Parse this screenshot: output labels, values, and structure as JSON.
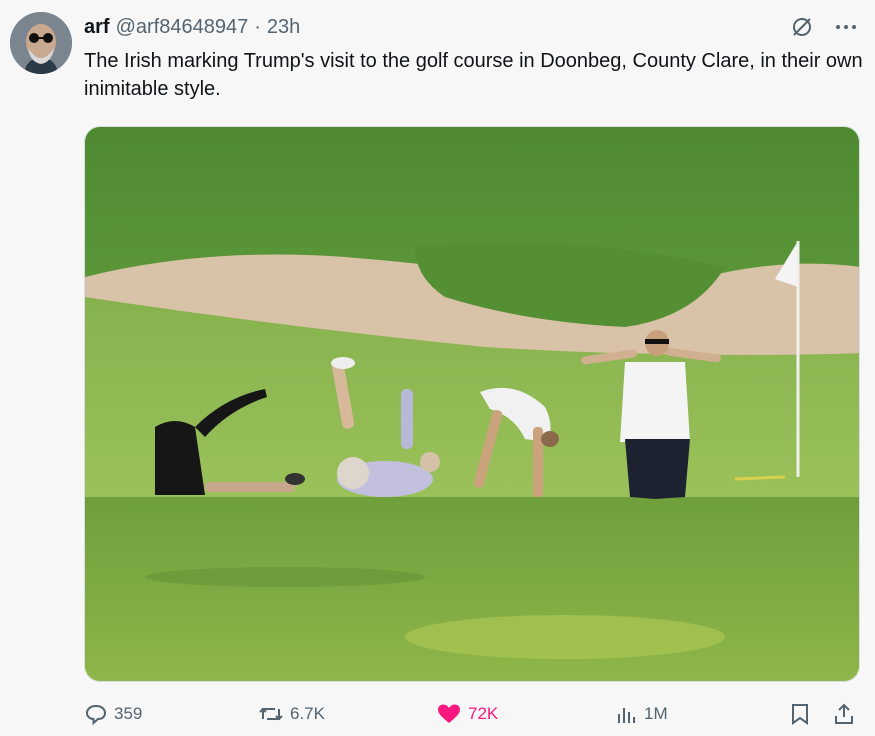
{
  "tweet": {
    "display_name": "arf",
    "handle": "@arf84648947",
    "separator": "·",
    "time": "23h",
    "text": "The Irish marking Trump's visit to the golf course in Doonbeg, County Clare, in their own inimitable style."
  },
  "icons": {
    "grok": "grok-icon",
    "more": "more-icon",
    "reply": "reply-icon",
    "repost": "repost-icon",
    "like": "heart-icon",
    "views": "views-icon",
    "bookmark": "bookmark-icon",
    "share": "share-icon"
  },
  "actions": {
    "replies": "359",
    "reposts": "6.7K",
    "likes": "72K",
    "views": "1M"
  },
  "colors": {
    "like_active": "#f91880",
    "muted": "#536471",
    "text": "#0f1419"
  }
}
